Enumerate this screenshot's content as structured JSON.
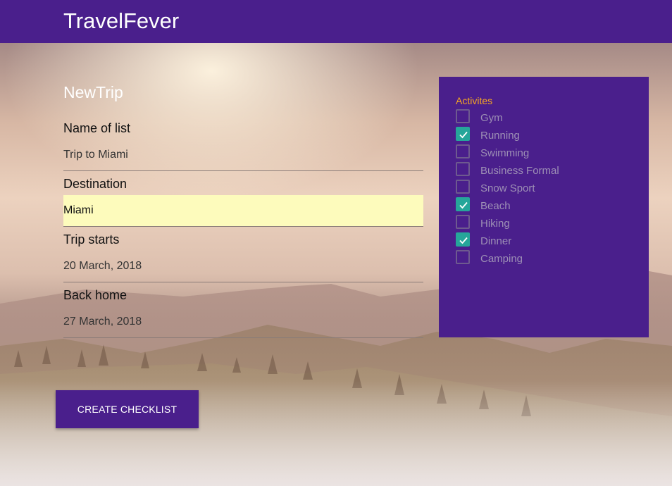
{
  "header": {
    "title": "TravelFever"
  },
  "form": {
    "title": "NewTrip",
    "fields": [
      {
        "label": "Name of list",
        "value": "Trip to Miami"
      },
      {
        "label": "Destination",
        "value": "Miami"
      },
      {
        "label": "Trip starts",
        "value": "20 March, 2018"
      },
      {
        "label": "Back home",
        "value": "27 March, 2018"
      }
    ],
    "submit_label": "CREATE CHECKLIST"
  },
  "activities": {
    "title": "Activites",
    "items": [
      {
        "label": "Gym",
        "checked": false
      },
      {
        "label": "Running",
        "checked": true
      },
      {
        "label": "Swimming",
        "checked": false
      },
      {
        "label": "Business Formal",
        "checked": false
      },
      {
        "label": "Snow Sport",
        "checked": false
      },
      {
        "label": "Beach",
        "checked": true
      },
      {
        "label": "Hiking",
        "checked": false
      },
      {
        "label": "Dinner",
        "checked": true
      },
      {
        "label": "Camping",
        "checked": false
      }
    ]
  },
  "colors": {
    "brand": "#4a1f8c",
    "accent": "#f5a623",
    "checked": "#26a69a",
    "autofill": "#fdfbbc"
  }
}
